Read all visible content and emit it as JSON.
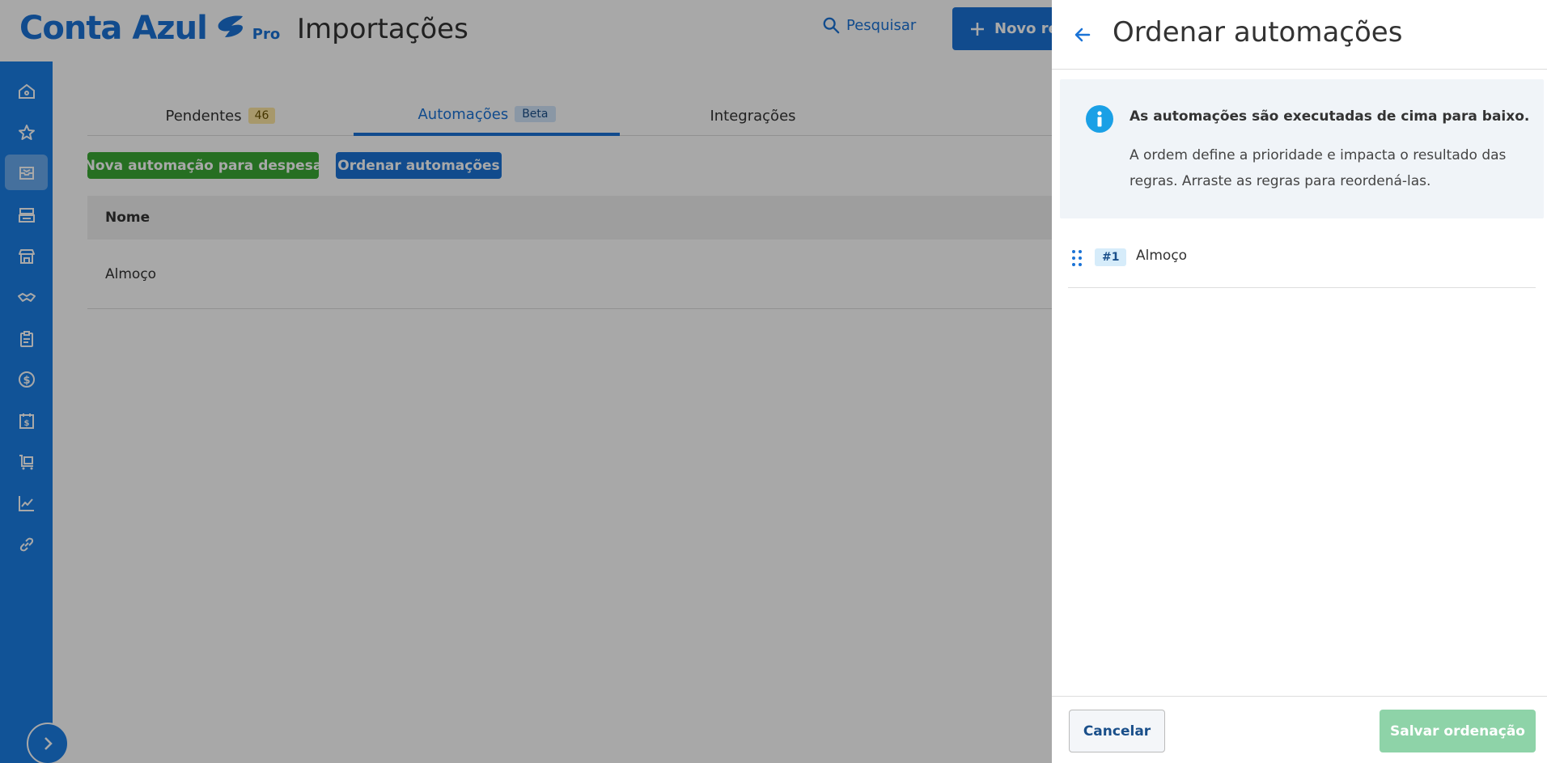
{
  "app": {
    "brand": "Conta Azul",
    "brand_tier": "Pro",
    "page_title": "Importações",
    "search_label": "Pesquisar",
    "new_button_label": "Novo re",
    "colors": {
      "brand_blue": "#1a73d6",
      "sidebar_blue": "#1a7ee6",
      "green": "#3aa935"
    }
  },
  "sidebar": {
    "items": [
      {
        "icon": "home-icon"
      },
      {
        "icon": "star-icon"
      },
      {
        "icon": "inbox-icon",
        "active": true
      },
      {
        "icon": "register-icon"
      },
      {
        "icon": "store-icon"
      },
      {
        "icon": "handshake-icon"
      },
      {
        "icon": "clipboard-icon"
      },
      {
        "icon": "dollar-icon"
      },
      {
        "icon": "calendar-dollar-icon"
      },
      {
        "icon": "cart-icon"
      },
      {
        "icon": "chart-line-icon"
      },
      {
        "icon": "link-icon"
      }
    ]
  },
  "tabs": [
    {
      "label": "Pendentes",
      "badge": "46"
    },
    {
      "label": "Automações",
      "badge": "Beta",
      "active": true
    },
    {
      "label": "Integrações"
    }
  ],
  "actions": {
    "new_automation": "Nova automação para despesa",
    "order_automations": "Ordenar automações"
  },
  "table": {
    "column_name": "Nome",
    "rows": [
      {
        "name": "Almoço"
      }
    ]
  },
  "drawer": {
    "title": "Ordenar automações",
    "info_title": "As automações são executadas de cima para baixo.",
    "info_description": "A ordem define a prioridade e impacta o resultado das regras. Arraste as regras para reordená-las.",
    "rules": [
      {
        "index": "#1",
        "name": "Almoço"
      }
    ],
    "cancel_label": "Cancelar",
    "save_label": "Salvar ordenação"
  }
}
